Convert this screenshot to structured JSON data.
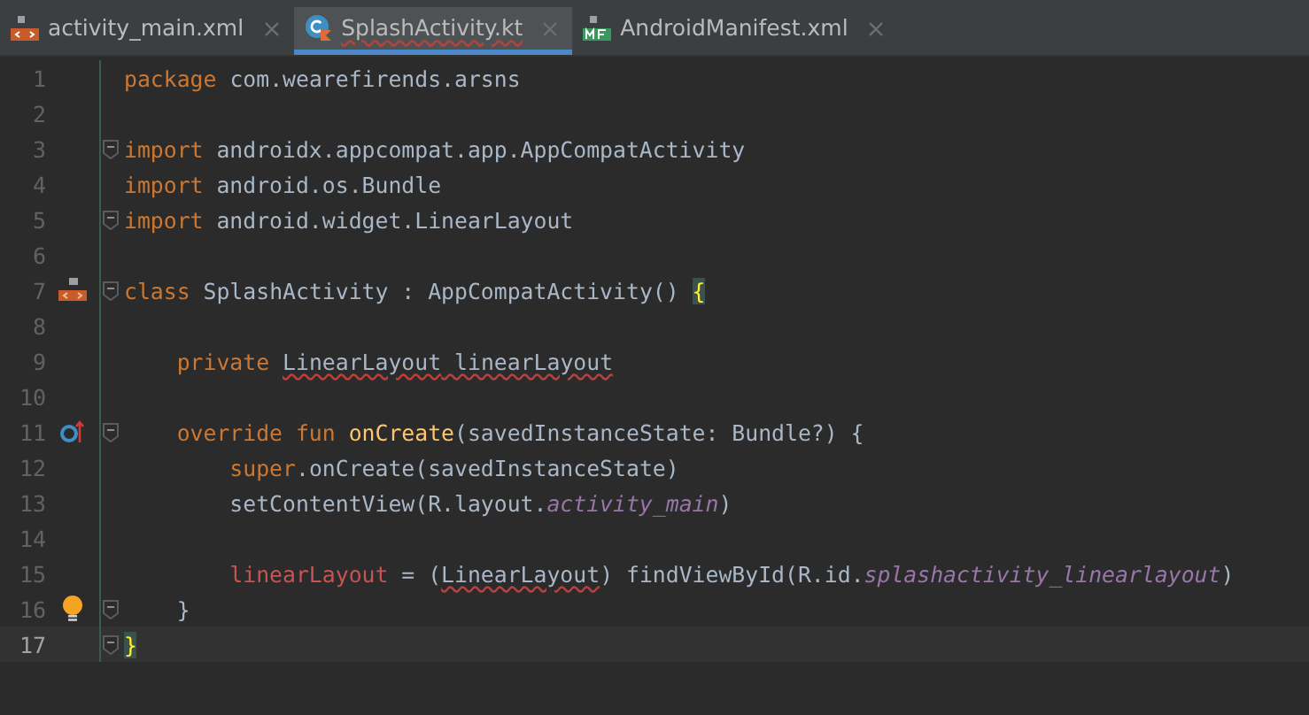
{
  "tabs": [
    {
      "label": "activity_main.xml",
      "kind": "xml",
      "selected": false,
      "error": false
    },
    {
      "label": "SplashActivity.kt",
      "kind": "kotlin",
      "selected": true,
      "error": true
    },
    {
      "label": "AndroidManifest.xml",
      "kind": "manifest",
      "selected": false,
      "error": false
    }
  ],
  "lines": [
    {
      "number": "1",
      "current": false,
      "fold": false,
      "tokens": [
        {
          "text": "package ",
          "kind": "kw"
        },
        {
          "text": "com.wearefirends.arsns",
          "kind": "plain"
        }
      ]
    },
    {
      "number": "2",
      "current": false,
      "fold": false
    },
    {
      "number": "3",
      "current": false,
      "fold": true,
      "tokens": [
        {
          "text": "import ",
          "kind": "kw"
        },
        {
          "text": "androidx.appcompat.app.AppCompatActivity",
          "kind": "plain"
        }
      ]
    },
    {
      "number": "4",
      "current": false,
      "fold": false,
      "tokens": [
        {
          "text": "import ",
          "kind": "kw"
        },
        {
          "text": "android.os.Bundle",
          "kind": "plain"
        }
      ]
    },
    {
      "number": "5",
      "current": false,
      "fold": true,
      "tokens": [
        {
          "text": "import ",
          "kind": "kw"
        },
        {
          "text": "android.widget.LinearLayout",
          "kind": "plain"
        }
      ]
    },
    {
      "number": "6",
      "current": false,
      "fold": false
    },
    {
      "number": "7",
      "current": false,
      "fold": true,
      "gutter_icon": {
        "kind": "layout"
      },
      "tokens": [
        {
          "text": "class ",
          "kind": "kw"
        },
        {
          "text": "SplashActivity : AppCompatActivity() ",
          "kind": "plain"
        },
        {
          "text": "{",
          "kind": "brace"
        }
      ]
    },
    {
      "number": "8",
      "current": false,
      "fold": false
    },
    {
      "number": "9",
      "current": false,
      "fold": false,
      "tokens": [
        {
          "text": "    private ",
          "kind": "kw"
        },
        {
          "text": "LinearLayout",
          "kind": "error"
        },
        {
          "text": " linearLayout",
          "kind": "error"
        }
      ]
    },
    {
      "number": "10",
      "current": false,
      "fold": false
    },
    {
      "number": "11",
      "current": false,
      "fold": true,
      "gutter_icon": {
        "kind": "override"
      },
      "tokens": [
        {
          "text": "    override fun ",
          "kind": "kw"
        },
        {
          "text": "onCreate",
          "kind": "fn"
        },
        {
          "text": "(savedInstanceState: Bundle?) {",
          "kind": "plain"
        }
      ]
    },
    {
      "number": "12",
      "current": false,
      "fold": false,
      "tokens": [
        {
          "text": "        super",
          "kind": "kw"
        },
        {
          "text": ".onCreate(savedInstanceState)",
          "kind": "plain"
        }
      ]
    },
    {
      "number": "13",
      "current": false,
      "fold": false,
      "tokens": [
        {
          "text": "        setContentView(R.layout.",
          "kind": "plain"
        },
        {
          "text": "activity_main",
          "kind": "field"
        },
        {
          "text": ")",
          "kind": "plain"
        }
      ]
    },
    {
      "number": "14",
      "current": false,
      "fold": false
    },
    {
      "number": "15",
      "current": false,
      "fold": false,
      "tokens": [
        {
          "text": "        linearLayout",
          "kind": "var"
        },
        {
          "text": " = (",
          "kind": "plain"
        },
        {
          "text": "LinearLayout",
          "kind": "error"
        },
        {
          "text": ") findViewById(R.id.",
          "kind": "plain"
        },
        {
          "text": "splashactivity_linearlayout",
          "kind": "field"
        },
        {
          "text": ")",
          "kind": "plain"
        }
      ]
    },
    {
      "number": "16",
      "current": false,
      "fold": true,
      "gutter_icon": {
        "kind": "bulb"
      },
      "tokens": [
        {
          "text": "    }",
          "kind": "plain"
        }
      ]
    },
    {
      "number": "17",
      "current": true,
      "fold": true,
      "tokens": [
        {
          "text": "}",
          "kind": "brace"
        }
      ]
    }
  ]
}
